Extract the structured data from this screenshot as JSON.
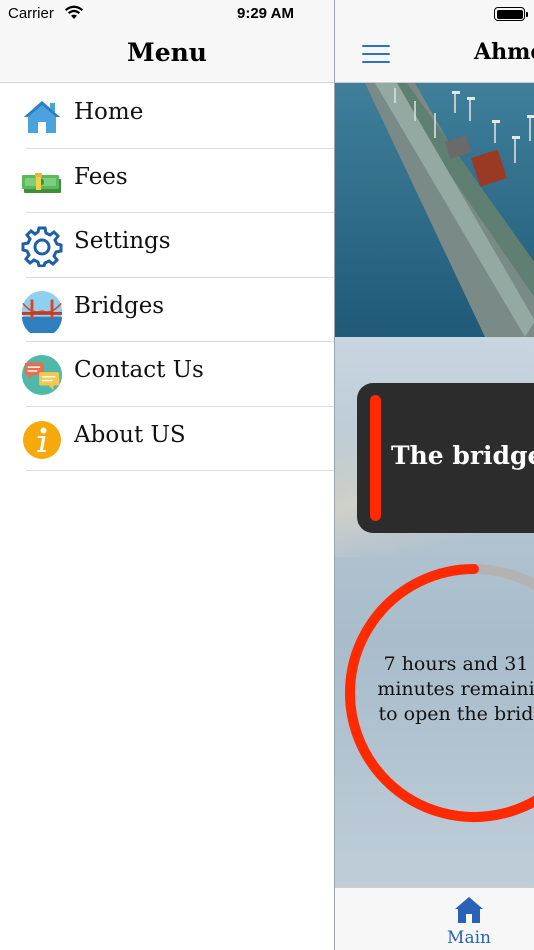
{
  "status_bar": {
    "carrier": "Carrier",
    "time": "9:29 AM"
  },
  "menu": {
    "title": "Menu",
    "items": [
      {
        "label": "Home",
        "icon": "home-icon"
      },
      {
        "label": "Fees",
        "icon": "money-icon"
      },
      {
        "label": "Settings",
        "icon": "gear-icon"
      },
      {
        "label": "Bridges",
        "icon": "bridge-icon"
      },
      {
        "label": "Contact Us",
        "icon": "chat-icon"
      },
      {
        "label": "About US",
        "icon": "info-icon"
      }
    ]
  },
  "main": {
    "title": "Ahme",
    "notice_text": "The bridge i",
    "timer": {
      "line1": "7 hours and 31",
      "line2": "minutes remaini",
      "line3": "to open the brid",
      "progress": 0.72
    },
    "tab": {
      "label": "Main",
      "icon": "home-icon"
    }
  },
  "colors": {
    "accent_blue": "#2a74c6",
    "timer_red": "#ff2a00",
    "timer_track": "#b3b3b3",
    "notice_bg": "#2c2c2c"
  }
}
